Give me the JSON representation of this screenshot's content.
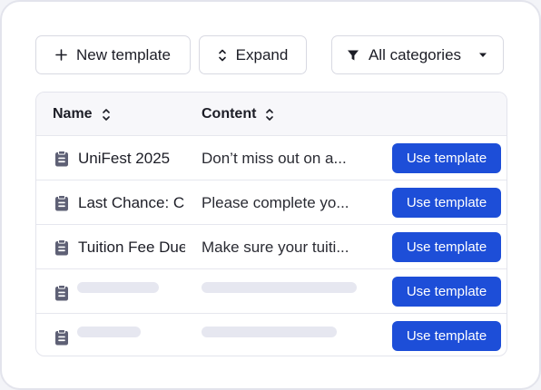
{
  "toolbar": {
    "new_template_label": "New template",
    "expand_label": "Expand",
    "category_filter_label": "All categories"
  },
  "table": {
    "columns": [
      "Name",
      "Content"
    ],
    "rows": [
      {
        "name": "UniFest 2025",
        "content": "Don’t miss out on a...",
        "action": "Use template"
      },
      {
        "name": "Last Chance: C",
        "content": "Please complete yo...",
        "action": "Use template"
      },
      {
        "name": "Tuition Fee Due",
        "content": "Make sure your tuiti...",
        "action": "Use template"
      },
      {
        "name": null,
        "content": null,
        "action": "Use template"
      },
      {
        "name": null,
        "content": null,
        "action": "Use template"
      }
    ]
  },
  "colors": {
    "accent": "#1d4ed8",
    "icon": "#5e6075",
    "skeleton": "#e6e7f0"
  },
  "icons": {
    "new_template": "plus-icon",
    "expand": "chevron-up-down-icon",
    "category_filter": "funnel-icon",
    "dropdown": "caret-down-icon",
    "sort": "sort-icon",
    "row": "clipboard-icon"
  }
}
